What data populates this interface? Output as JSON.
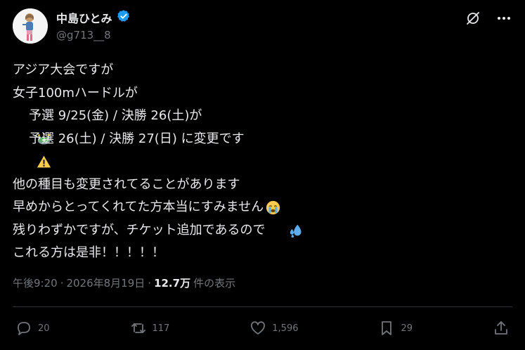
{
  "author": {
    "display_name": "中島ひとみ",
    "handle": "@g713__8",
    "verified_color": "#1d9bf0"
  },
  "tweet": {
    "lines": [
      {
        "text": "アジア大会ですが"
      },
      {
        "text": "女子100mハードルが"
      },
      {
        "icon": "stadium-emoji",
        "text": "予選 9/25(金) / 決勝 26(土)が"
      },
      {
        "icon": "warning-emoji",
        "text": "予選 26(土) / 決勝 27(日) に変更です"
      },
      {
        "text": ""
      },
      {
        "text": "他の種目も変更されてることがあります",
        "icon_after": "crying-face-emoji"
      },
      {
        "text": "早めからとってくれてた方本当にすみません",
        "icon_after": "sweat-droplets-emoji"
      },
      {
        "text": "残りわずかですが、チケット追加であるので"
      },
      {
        "text": "これる方は是非！！！！！"
      }
    ]
  },
  "meta": {
    "time": "午後9:20",
    "date": "2026年8月19日",
    "views_count": "12.7万",
    "views_label": "件の表示",
    "separator": "·"
  },
  "actions": {
    "replies": "20",
    "reposts": "117",
    "likes": "1,596",
    "bookmarks": "29"
  },
  "colors": {
    "background": "#000000",
    "text": "#e7e9ea",
    "secondary": "#71767b",
    "divider": "#2f3336",
    "verified": "#1d9bf0"
  }
}
